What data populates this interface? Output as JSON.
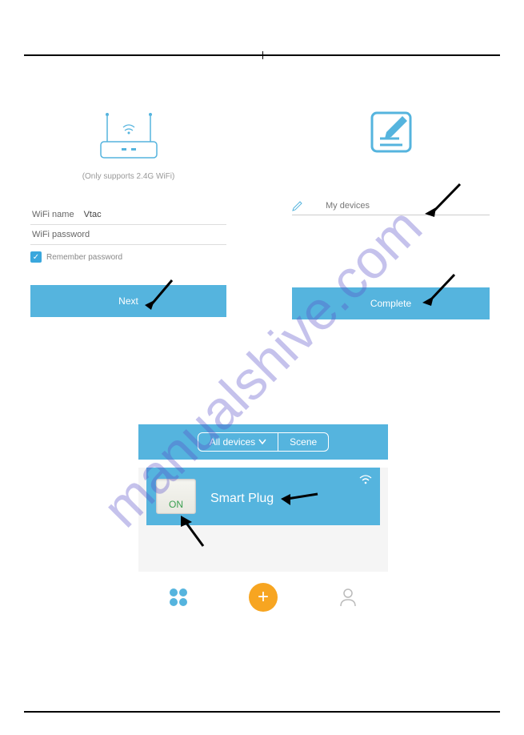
{
  "left": {
    "hint": "(Only supports 2.4G WiFi)",
    "wifi_name_label": "WiFi name",
    "wifi_name_value": "Vtac",
    "wifi_password_label": "WiFi password",
    "remember_label": "Remember password",
    "next_button": "Next"
  },
  "right": {
    "devices_label": "My devices",
    "complete_button": "Complete"
  },
  "bottom": {
    "tab_all": "All devices",
    "tab_scene": "Scene",
    "switch_state": "ON",
    "device_name": "Smart Plug"
  },
  "watermark": "manualshive.com"
}
